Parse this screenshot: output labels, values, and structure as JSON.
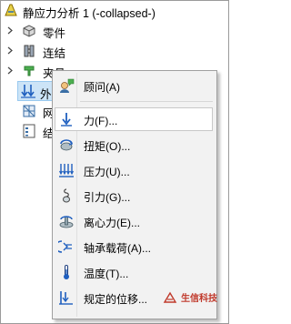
{
  "tree": {
    "root_label": "静应力分析 1 (-collapsed-)",
    "items": [
      {
        "label": "零件"
      },
      {
        "label": "连结"
      },
      {
        "label": "夹具"
      },
      {
        "label": "外部载荷"
      },
      {
        "label": "网格"
      },
      {
        "label": "结果"
      }
    ]
  },
  "context_menu": {
    "items": [
      {
        "label": "顾问(A)",
        "icon": "advisor-icon"
      },
      {
        "label": "力(F)...",
        "icon": "force-arrow-icon",
        "highlighted": true
      },
      {
        "label": "扭矩(O)...",
        "icon": "torque-icon"
      },
      {
        "label": "压力(U)...",
        "icon": "pressure-icon"
      },
      {
        "label": "引力(G)...",
        "icon": "gravity-icon"
      },
      {
        "label": "离心力(E)...",
        "icon": "centrifugal-icon"
      },
      {
        "label": "轴承载荷(A)...",
        "icon": "bearing-load-icon"
      },
      {
        "label": "温度(T)...",
        "icon": "thermometer-icon"
      },
      {
        "label": "规定的位移...",
        "icon": "prescribed-displacement-icon"
      }
    ]
  },
  "watermark": {
    "text": "生信科技"
  },
  "colors": {
    "selection": "#cce4f7",
    "menu_bg": "#f2f2f2",
    "icon_blue": "#1f5fbf",
    "watermark_red": "#c0392b"
  }
}
